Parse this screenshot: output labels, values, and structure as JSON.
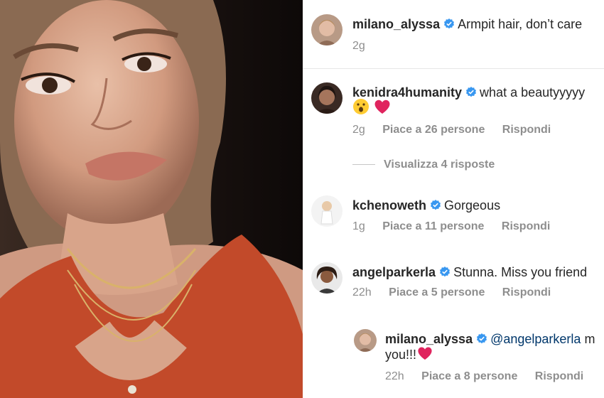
{
  "colors": {
    "verified": "#3897f0",
    "muted": "#8e8e8e",
    "mention": "#00376b",
    "heart": "#e0245e"
  },
  "comments": [
    {
      "username": "milano_alyssa",
      "verified": true,
      "text": "Armpit hair, don’t care",
      "time": "2g",
      "likes": "",
      "reply_label": ""
    },
    {
      "username": "kenidra4humanity",
      "verified": true,
      "text": "what a beautyyyyy",
      "emojis": [
        "face-with-open-mouth",
        "red-heart"
      ],
      "time": "2g",
      "likes": "Piace a 26 persone",
      "reply_label": "Rispondi",
      "view_replies": "Visualizza 4 risposte"
    },
    {
      "username": "kchenoweth",
      "verified": true,
      "text": "Gorgeous",
      "time": "1g",
      "likes": "Piace a 11 persone",
      "reply_label": "Rispondi"
    },
    {
      "username": "angelparkerla",
      "verified": true,
      "text": "Stunna. Miss you friend",
      "time": "22h",
      "likes": "Piace a 5 persone",
      "reply_label": "Rispondi"
    }
  ],
  "reply": {
    "username": "milano_alyssa",
    "verified": true,
    "mention": "@angelparkerla",
    "text_tail": "m",
    "line2": "you!!!",
    "emoji": "red-heart",
    "time": "22h",
    "likes": "Piace a 8 persone",
    "reply_label": "Rispondi"
  }
}
